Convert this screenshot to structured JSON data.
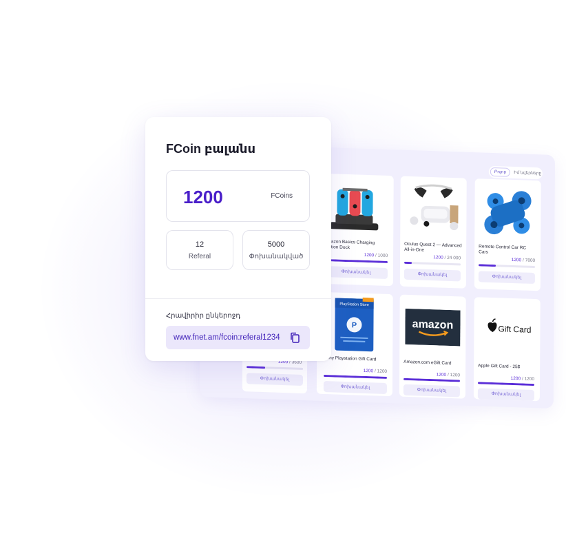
{
  "balance": {
    "title": "FCoin բալանս",
    "amount": "1200",
    "unit": "FCoins",
    "referal_count": "12",
    "referal_label": "Referal",
    "exchanged_count": "5000",
    "exchanged_label": "Փոխանակված",
    "invite_label": "Հրավիրիր ընկերոջդ",
    "referral_link": "www.fnet.am/fcoin:referal1234"
  },
  "store": {
    "tabs": [
      {
        "label": "Բոլոր",
        "active": true
      },
      {
        "label": "Իմ նվերները",
        "active": false
      }
    ],
    "products": [
      {
        "name": "Amazon Basics Charging Station Dock",
        "current": "1200",
        "total": "1000",
        "progress": 1.0,
        "button": "Փոխանակել",
        "icon": "nintendo-dock-image"
      },
      {
        "name": "Oculus Quest 2 — Advanced All-in-One",
        "current": "1200",
        "total": "24 000",
        "progress": 0.05,
        "button": "Փոխանակել",
        "icon": "vr-headset-image"
      },
      {
        "name": "Remote Control Car RC Cars",
        "current": "1200",
        "total": "7800",
        "progress": 0.3,
        "button": "Փոխանակել",
        "icon": "rc-car-image"
      },
      {
        "name": "",
        "current": "1200",
        "total": "3600",
        "progress": 0.33,
        "button": "Փոխանակել",
        "icon": "hidden-product-image"
      },
      {
        "name": "Sony Playstation Gift Card",
        "current": "1200",
        "total": "1200",
        "progress": 1.0,
        "button": "Փոխանակել",
        "icon": "playstation-card-image"
      },
      {
        "name": "Amazon.com eGift Card",
        "current": "1200",
        "total": "1200",
        "progress": 1.0,
        "button": "Փոխանակել",
        "icon": "amazon-card-image"
      },
      {
        "name": "Apple Gift Card - 25$",
        "current": "1200",
        "total": "1200",
        "progress": 1.0,
        "button": "Փոխանակել",
        "icon": "apple-gift-card-image"
      }
    ],
    "playstation_card_text": "PlayStation Store",
    "amazon_card_text": "amazon",
    "apple_card_text": "Gift Card"
  },
  "colors": {
    "accent": "#5b2ed8",
    "accent_dark": "#4a1fc9",
    "panel_bg": "#f1effd",
    "link_bg": "#ebe7fb"
  }
}
